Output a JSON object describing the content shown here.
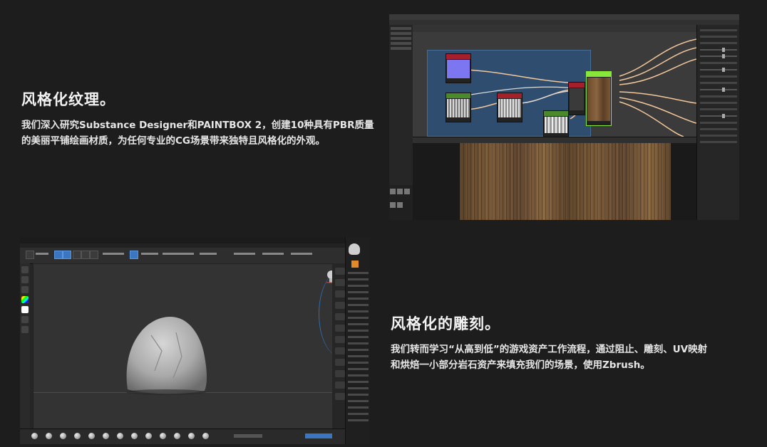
{
  "section1": {
    "title": "风格化纹理。",
    "desc_line1": "我们深入研究Substance Designer和PAINTBOX 2，创建10种具有PBR质量",
    "desc_line2": "的美丽平铺绘画材质，为任何专业的CG场景带来独特且风格化的外观。"
  },
  "section2": {
    "title": "风格化的雕刻。",
    "desc_line1": "我们转而学习“从高到低”的游戏资产工作流程，通过阻止、雕刻、UV映射",
    "desc_line2": "和烘焙一小部分岩石资产来填充我们的场景，使用Zbrush。"
  },
  "colors": {
    "background": "#1d1d1d",
    "sd_frame": "#2f4d6e",
    "node_purple": "#7c76f0",
    "node_green": "#88e83a",
    "node_red_header": "#a4202a",
    "wire": "#f2c79a",
    "zbrush_accent": "#3b76c2"
  },
  "screenshots": {
    "substance_designer": {
      "alt_icon": "substance-designer-screenshot"
    },
    "zbrush": {
      "alt_icon": "zbrush-screenshot"
    }
  }
}
